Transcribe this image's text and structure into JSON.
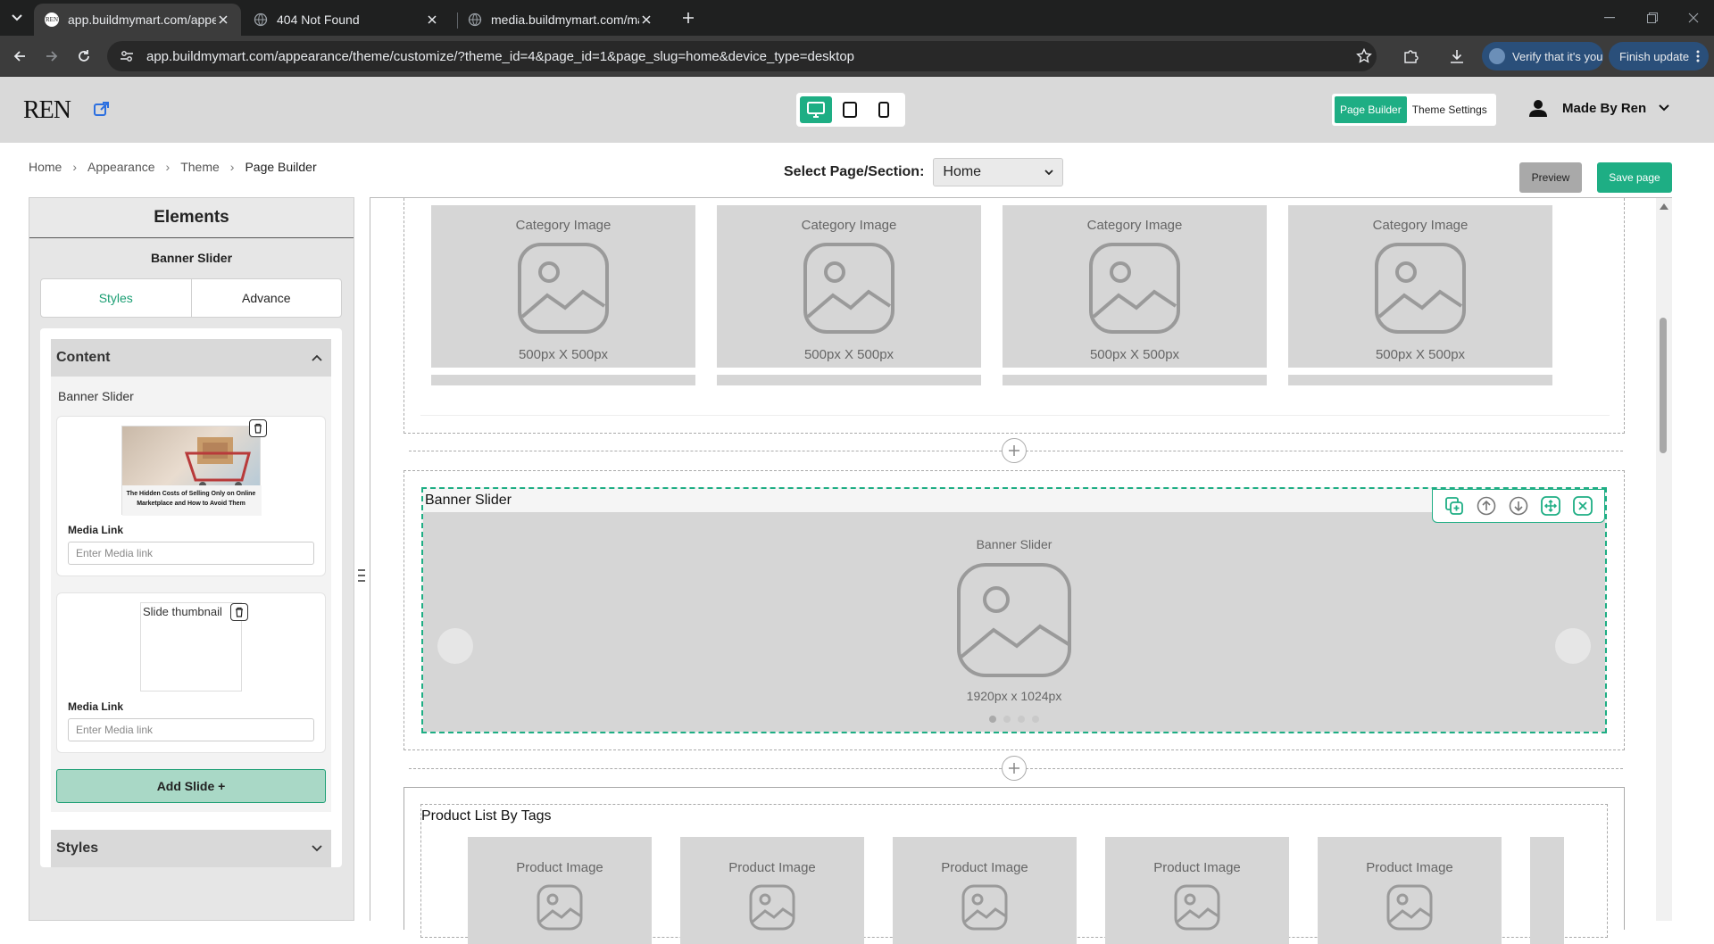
{
  "browser": {
    "tabs": [
      {
        "title": "app.buildmymart.com/appearan",
        "active": true
      },
      {
        "title": "404 Not Found",
        "active": false
      },
      {
        "title": "media.buildmymart.com/madeb",
        "active": false
      }
    ],
    "url": "app.buildmymart.com/appearance/theme/customize/?theme_id=4&page_id=1&page_slug=home&device_type=desktop",
    "verify_label": "Verify that it's you",
    "finish_update_label": "Finish update"
  },
  "header": {
    "logo_text": "REN",
    "mode_tabs": [
      {
        "label": "Page Builder",
        "active": true
      },
      {
        "label": "Theme Settings",
        "active": false
      }
    ],
    "user_name": "Made By Ren",
    "accent_color": "#1eae84"
  },
  "breadcrumb": [
    "Home",
    "Appearance",
    "Theme",
    "Page Builder"
  ],
  "page_select": {
    "label": "Select Page/Section:",
    "value": "Home"
  },
  "actions": {
    "preview": "Preview",
    "save": "Save page"
  },
  "panel": {
    "title": "Elements",
    "subtitle": "Banner Slider",
    "tabs": [
      {
        "label": "Styles",
        "active": true
      },
      {
        "label": "Advance",
        "active": false
      }
    ],
    "content_heading": "Content",
    "content_label": "Banner Slider",
    "slides": [
      {
        "thumb_caption": "The Hidden Costs of Selling Only on Online Marketplace and How to Avoid Them",
        "media_link_label": "Media Link",
        "media_link_placeholder": "Enter Media link"
      },
      {
        "thumb_alt": "Slide thumbnail",
        "media_link_label": "Media Link",
        "media_link_placeholder": "Enter Media link"
      }
    ],
    "add_slide": "Add Slide +",
    "styles_heading": "Styles"
  },
  "canvas": {
    "categories": [
      {
        "label": "Category Image",
        "size": "500px X 500px"
      },
      {
        "label": "Category Image",
        "size": "500px X 500px"
      },
      {
        "label": "Category Image",
        "size": "500px X 500px"
      },
      {
        "label": "Category Image",
        "size": "500px X 500px"
      }
    ],
    "banner": {
      "title": "Banner Slider",
      "label": "Banner Slider",
      "size": "1920px x 1024px",
      "slide_count": 4,
      "active_slide": 1
    },
    "product_section": {
      "title": "Product List By Tags",
      "products": [
        "Product Image",
        "Product Image",
        "Product Image",
        "Product Image",
        "Product Image"
      ]
    }
  }
}
